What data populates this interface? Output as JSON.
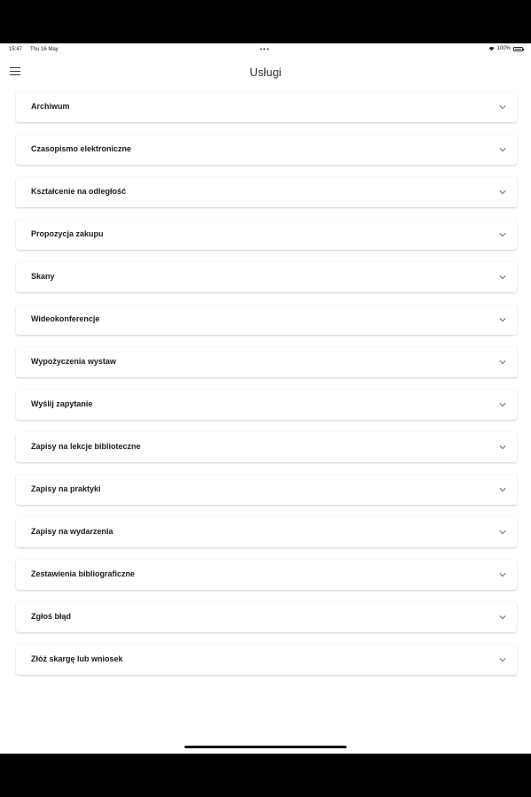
{
  "status": {
    "time": "15:47",
    "date": "Thu 16 May",
    "battery": "100%"
  },
  "header": {
    "title": "Usługi"
  },
  "services": [
    {
      "label": "Archiwum"
    },
    {
      "label": "Czasopismo elektroniczne"
    },
    {
      "label": "Kształcenie na odległość"
    },
    {
      "label": "Propozycja zakupu"
    },
    {
      "label": "Skany"
    },
    {
      "label": "Wideokonferencje"
    },
    {
      "label": "Wypożyczenia wystaw"
    },
    {
      "label": "Wyślij zapytanie"
    },
    {
      "label": "Zapisy na lekcje biblioteczne"
    },
    {
      "label": "Zapisy na praktyki"
    },
    {
      "label": "Zapisy na wydarzenia"
    },
    {
      "label": "Zestawienia bibliograficzne"
    },
    {
      "label": "Zgłoś błąd"
    },
    {
      "label": "Złóż skargę lub wniosek"
    }
  ]
}
